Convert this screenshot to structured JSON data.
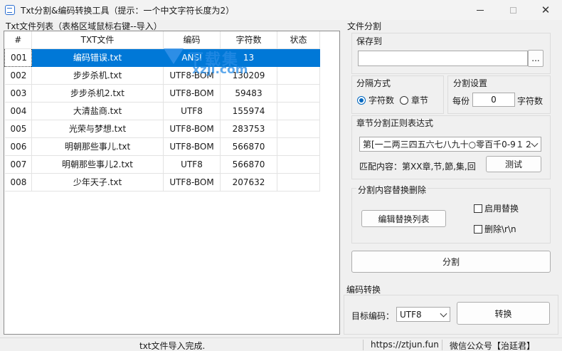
{
  "window": {
    "title": "Txt分割&编码转换工具（提示：一个中文字符长度为2）",
    "min_glyph": "",
    "max_glyph": "",
    "close_glyph": "✕"
  },
  "file_list": {
    "group_label": "Txt文件列表（表格区域鼠标右键--导入）",
    "columns": [
      "#",
      "TXT文件",
      "编码",
      "字符数",
      "状态"
    ],
    "rows": [
      {
        "id": "001",
        "file": "编码错误.txt",
        "encoding": "ANSI",
        "chars": "13",
        "status": ""
      },
      {
        "id": "002",
        "file": "步步杀机.txt",
        "encoding": "UTF8-BOM",
        "chars": "130209",
        "status": ""
      },
      {
        "id": "003",
        "file": "步步杀机2.txt",
        "encoding": "UTF8-BOM",
        "chars": "59483",
        "status": ""
      },
      {
        "id": "004",
        "file": "大清盐商.txt",
        "encoding": "UTF8",
        "chars": "155974",
        "status": ""
      },
      {
        "id": "005",
        "file": "光荣与梦想.txt",
        "encoding": "UTF8-BOM",
        "chars": "283753",
        "status": ""
      },
      {
        "id": "006",
        "file": "明朝那些事儿.txt",
        "encoding": "UTF8-BOM",
        "chars": "566870",
        "status": ""
      },
      {
        "id": "007",
        "file": "明朝那些事儿2.txt",
        "encoding": "UTF8",
        "chars": "566870",
        "status": ""
      },
      {
        "id": "008",
        "file": "少年天子.txt",
        "encoding": "UTF8-BOM",
        "chars": "207632",
        "status": ""
      }
    ],
    "selected_row": 0
  },
  "watermark": {
    "line1": "下载集",
    "line2": "xzji.com"
  },
  "split": {
    "group_label": "文件分割",
    "save_to_label": "保存到",
    "save_path_value": "",
    "browse_label": "...",
    "mode_label": "分隔方式",
    "mode_options": [
      "字符数",
      "章节"
    ],
    "mode_selected": "字符数",
    "settings_label": "分割设置",
    "per_label": "每份",
    "per_value": "0",
    "unit_label": "字符数",
    "regex_label": "章节分割正则表达式",
    "regex_value": "第[一二两三四五六七八九十○零百千0-9１２",
    "match_label": "匹配内容：第XX章,节,節,集,回",
    "test_label": "测试",
    "replace_label": "分割内容替换删除",
    "edit_replace_label": "编辑替换列表",
    "enable_replace_label": "启用替换",
    "delete_newline_label": "删除\\r\\n",
    "split_button_label": "分割"
  },
  "encode": {
    "group_label": "编码转换",
    "target_label": "目标编码：",
    "target_value": "UTF8",
    "convert_label": "转换"
  },
  "status": {
    "message": "txt文件导入完成.",
    "url": "https://ztjun.fun",
    "wechat": "微信公众号【治廷君】"
  }
}
